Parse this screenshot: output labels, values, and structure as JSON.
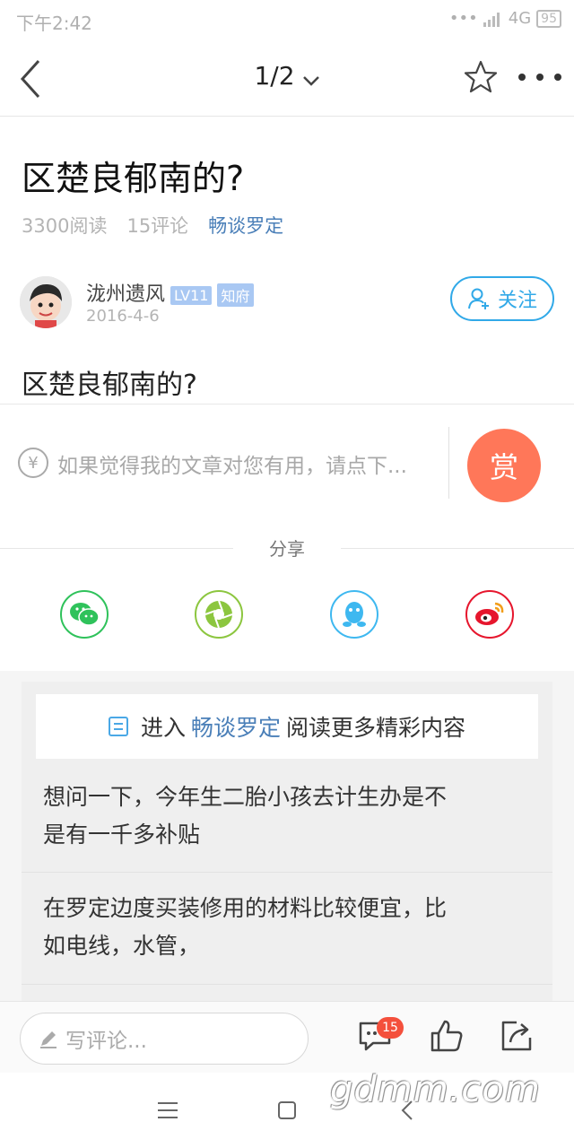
{
  "status_bar": {
    "time": "下午2:42",
    "network": "4G",
    "battery": "95"
  },
  "nav": {
    "page_indicator": "1/2"
  },
  "article": {
    "title": "区楚良郁南的?",
    "reads": "3300阅读",
    "comments": "15评论",
    "forum": "畅谈罗定",
    "body": "区楚良郁南的?"
  },
  "author": {
    "name": "泷州遗风",
    "level_badge": "LV11",
    "rank_badge": "知府",
    "date": "2016-4-6",
    "follow_label": "关注"
  },
  "reward": {
    "prompt": "如果觉得我的文章对您有用，请点下...",
    "button_label": "赏",
    "yen_symbol": "¥"
  },
  "share": {
    "label": "分享",
    "icons": [
      {
        "name": "wechat-icon",
        "color": "#2fc25b"
      },
      {
        "name": "moments-icon",
        "color": "#8cc63f"
      },
      {
        "name": "qq-icon",
        "color": "#3eb8f0"
      },
      {
        "name": "weibo-icon",
        "color": "#e6162d"
      }
    ]
  },
  "recommend": {
    "enter_prefix": "进入",
    "forum": "畅谈罗定",
    "enter_suffix": "阅读更多精彩内容",
    "posts": [
      {
        "line1": "想问一下，今年生二胎小孩去计生办是不",
        "line2": "是有一千多补贴"
      },
      {
        "line1": "在罗定边度买装修用的材料比较便宜，比",
        "line2": "如电线，水管，"
      }
    ]
  },
  "bottom_bar": {
    "comment_placeholder": "写评论...",
    "comment_count": "15"
  },
  "watermark": "gdmm.com",
  "colors": {
    "accent_blue": "#31a9e8",
    "link_blue": "#4a7fb8",
    "reward_orange": "#ff7759",
    "badge_red": "#f4503c"
  }
}
